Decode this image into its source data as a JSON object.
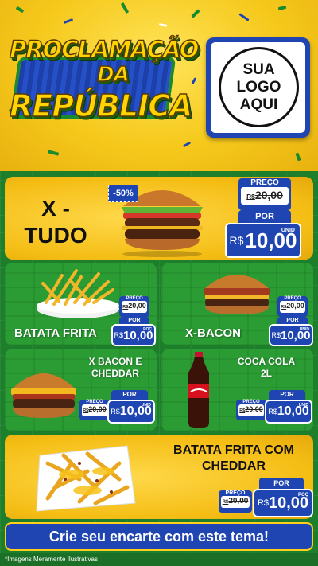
{
  "header": {
    "title_line1": "PROCLAMAÇÃO",
    "title_line2": "DA",
    "title_line3": "REPÚBLICA",
    "logo_line1": "SUA",
    "logo_line2": "LOGO",
    "logo_line3": "AQUI"
  },
  "featured": {
    "name_line1": "X -",
    "name_line2": "TUDO",
    "discount": "-50%",
    "old_label": "PREÇO",
    "old_currency": "R$",
    "old_price": "20,00",
    "por_label": "POR",
    "currency": "R$",
    "price": "10,00",
    "unit": "UNID"
  },
  "items": [
    {
      "name": "BATATA FRITA",
      "old_label": "PREÇO",
      "old_currency": "R$",
      "old_price": "20,00",
      "por_label": "POR",
      "currency": "R$",
      "price": "10,00",
      "unit": "POÇ"
    },
    {
      "name": "X-BACON",
      "old_label": "PREÇO",
      "old_currency": "R$",
      "old_price": "20,00",
      "por_label": "POR",
      "currency": "R$",
      "price": "10,00",
      "unit": "UNID"
    },
    {
      "name_line1": "X BACON E",
      "name_line2": "CHEDDAR",
      "old_label": "PREÇO",
      "old_currency": "R$",
      "old_price": "20,00",
      "por_label": "POR",
      "currency": "R$",
      "price": "10,00",
      "unit": "UNID"
    },
    {
      "name_line1": "COCA COLA",
      "name_line2": "2L",
      "old_label": "PREÇO",
      "old_currency": "R$",
      "old_price": "20,00",
      "por_label": "POR",
      "currency": "R$",
      "price": "10,00",
      "unit": "UNID"
    },
    {
      "name_line1": "BATATA FRITA COM",
      "name_line2": "CHEDDAR",
      "old_label": "PREÇO",
      "old_currency": "R$",
      "old_price": "20,00",
      "por_label": "POR",
      "currency": "R$",
      "price": "10,00",
      "unit": "POÇ"
    }
  ],
  "cta_text": "Crie seu encarte com este tema!",
  "disclaimer": "*Imagens Meramente Ilustrativas",
  "colors": {
    "brand_blue": "#1f45b3",
    "brand_green": "#1d7f2b",
    "brand_yellow": "#f3c41b"
  },
  "icons": [
    "burger-image",
    "fries-image",
    "soda-bottle-image",
    "cheese-fries-image"
  ]
}
